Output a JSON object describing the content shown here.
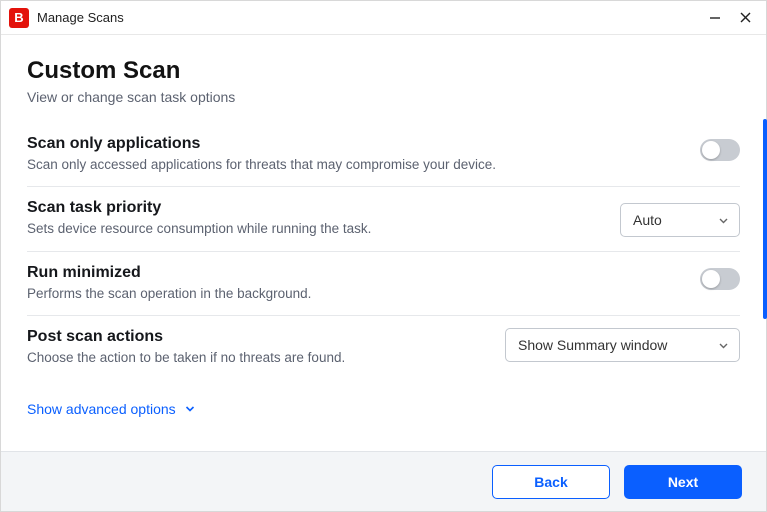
{
  "window": {
    "title": "Manage Scans",
    "app_icon_letter": "B"
  },
  "header": {
    "title": "Custom Scan",
    "subtitle": "View or change scan task options"
  },
  "sections": {
    "scan_only_apps": {
      "title": "Scan only applications",
      "desc": "Scan only accessed applications for threats that may compromise your device."
    },
    "priority": {
      "title": "Scan task priority",
      "desc": "Sets device resource consumption while running the task.",
      "value": "Auto"
    },
    "run_minimized": {
      "title": "Run minimized",
      "desc": "Performs the scan operation in the background."
    },
    "post_scan": {
      "title": "Post scan actions",
      "desc": "Choose the action to be taken if no threats are found.",
      "value": "Show Summary window"
    }
  },
  "advanced": {
    "label": "Show advanced options"
  },
  "footer": {
    "back": "Back",
    "next": "Next"
  }
}
